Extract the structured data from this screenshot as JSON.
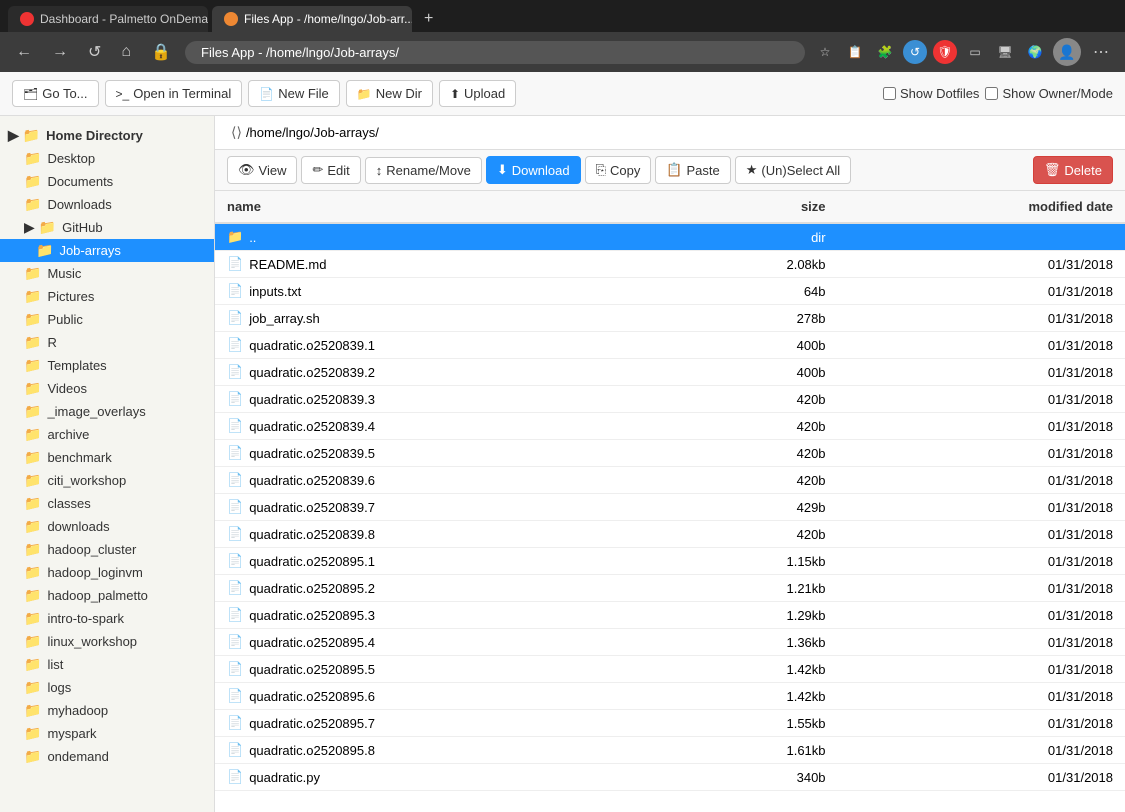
{
  "browser": {
    "tabs": [
      {
        "id": "tab1",
        "label": "Dashboard - Palmetto OnDema...",
        "active": false,
        "faviconColor": "red"
      },
      {
        "id": "tab2",
        "label": "Files App - /home/lngo/Job-arr...",
        "active": true,
        "faviconColor": "orange"
      }
    ],
    "new_tab_label": "+",
    "address": "Files App - /home/lngo/Job-arrays/",
    "nav": {
      "back": "←",
      "forward": "→",
      "reload": "↺",
      "home": "⌂",
      "lock": "🔒"
    }
  },
  "toolbar": {
    "goto_label": "Go To...",
    "terminal_label": "Open in Terminal",
    "new_file_label": "New File",
    "new_dir_label": "New Dir",
    "upload_label": "Upload",
    "show_dotfiles_label": "Show Dotfiles",
    "show_owner_label": "Show Owner/Mode"
  },
  "breadcrumb": {
    "icon": "⟨⟩",
    "path": "/home/lngo/Job-arrays/"
  },
  "file_toolbar": {
    "view_label": "View",
    "edit_label": "Edit",
    "rename_label": "Rename/Move",
    "download_label": "Download",
    "copy_label": "Copy",
    "paste_label": "Paste",
    "unselect_label": "(Un)Select All",
    "delete_label": "Delete"
  },
  "file_list": {
    "columns": [
      "name",
      "size",
      "modified date"
    ],
    "rows": [
      {
        "name": "..",
        "icon": "📁",
        "size": "dir",
        "date": "",
        "type": "dir",
        "selected": true
      },
      {
        "name": "README.md",
        "icon": "📄",
        "size": "2.08kb",
        "date": "01/31/2018",
        "type": "file"
      },
      {
        "name": "inputs.txt",
        "icon": "📄",
        "size": "64b",
        "date": "01/31/2018",
        "type": "file"
      },
      {
        "name": "job_array.sh",
        "icon": "📄",
        "size": "278b",
        "date": "01/31/2018",
        "type": "file"
      },
      {
        "name": "quadratic.o2520839.1",
        "icon": "📄",
        "size": "400b",
        "date": "01/31/2018",
        "type": "file"
      },
      {
        "name": "quadratic.o2520839.2",
        "icon": "📄",
        "size": "400b",
        "date": "01/31/2018",
        "type": "file"
      },
      {
        "name": "quadratic.o2520839.3",
        "icon": "📄",
        "size": "420b",
        "date": "01/31/2018",
        "type": "file"
      },
      {
        "name": "quadratic.o2520839.4",
        "icon": "📄",
        "size": "420b",
        "date": "01/31/2018",
        "type": "file"
      },
      {
        "name": "quadratic.o2520839.5",
        "icon": "📄",
        "size": "420b",
        "date": "01/31/2018",
        "type": "file"
      },
      {
        "name": "quadratic.o2520839.6",
        "icon": "📄",
        "size": "420b",
        "date": "01/31/2018",
        "type": "file"
      },
      {
        "name": "quadratic.o2520839.7",
        "icon": "📄",
        "size": "429b",
        "date": "01/31/2018",
        "type": "file"
      },
      {
        "name": "quadratic.o2520839.8",
        "icon": "📄",
        "size": "420b",
        "date": "01/31/2018",
        "type": "file"
      },
      {
        "name": "quadratic.o2520895.1",
        "icon": "📄",
        "size": "1.15kb",
        "date": "01/31/2018",
        "type": "file"
      },
      {
        "name": "quadratic.o2520895.2",
        "icon": "📄",
        "size": "1.21kb",
        "date": "01/31/2018",
        "type": "file"
      },
      {
        "name": "quadratic.o2520895.3",
        "icon": "📄",
        "size": "1.29kb",
        "date": "01/31/2018",
        "type": "file"
      },
      {
        "name": "quadratic.o2520895.4",
        "icon": "📄",
        "size": "1.36kb",
        "date": "01/31/2018",
        "type": "file"
      },
      {
        "name": "quadratic.o2520895.5",
        "icon": "📄",
        "size": "1.42kb",
        "date": "01/31/2018",
        "type": "file"
      },
      {
        "name": "quadratic.o2520895.6",
        "icon": "📄",
        "size": "1.42kb",
        "date": "01/31/2018",
        "type": "file"
      },
      {
        "name": "quadratic.o2520895.7",
        "icon": "📄",
        "size": "1.55kb",
        "date": "01/31/2018",
        "type": "file"
      },
      {
        "name": "quadratic.o2520895.8",
        "icon": "📄",
        "size": "1.61kb",
        "date": "01/31/2018",
        "type": "file"
      },
      {
        "name": "quadratic.py",
        "icon": "📄",
        "size": "340b",
        "date": "01/31/2018",
        "type": "file"
      }
    ]
  },
  "sidebar": {
    "root_label": "Home Directory",
    "items": [
      {
        "id": "desktop",
        "label": "Desktop",
        "level": "level1",
        "selected": false
      },
      {
        "id": "documents",
        "label": "Documents",
        "level": "level1",
        "selected": false
      },
      {
        "id": "downloads",
        "label": "Downloads",
        "level": "level1",
        "selected": false
      },
      {
        "id": "github",
        "label": "GitHub",
        "level": "level1",
        "selected": false
      },
      {
        "id": "job-arrays",
        "label": "Job-arrays",
        "level": "level2",
        "selected": true
      },
      {
        "id": "music",
        "label": "Music",
        "level": "level1",
        "selected": false
      },
      {
        "id": "pictures",
        "label": "Pictures",
        "level": "level1",
        "selected": false
      },
      {
        "id": "public",
        "label": "Public",
        "level": "level1",
        "selected": false
      },
      {
        "id": "r",
        "label": "R",
        "level": "level1",
        "selected": false
      },
      {
        "id": "templates",
        "label": "Templates",
        "level": "level1",
        "selected": false
      },
      {
        "id": "videos",
        "label": "Videos",
        "level": "level1",
        "selected": false
      },
      {
        "id": "image_overlays",
        "label": "_image_overlays",
        "level": "level1",
        "selected": false
      },
      {
        "id": "archive",
        "label": "archive",
        "level": "level1",
        "selected": false
      },
      {
        "id": "benchmark",
        "label": "benchmark",
        "level": "level1",
        "selected": false
      },
      {
        "id": "citi_workshop",
        "label": "citi_workshop",
        "level": "level1",
        "selected": false
      },
      {
        "id": "classes",
        "label": "classes",
        "level": "level1",
        "selected": false
      },
      {
        "id": "downloads2",
        "label": "downloads",
        "level": "level1",
        "selected": false
      },
      {
        "id": "hadoop_cluster",
        "label": "hadoop_cluster",
        "level": "level1",
        "selected": false
      },
      {
        "id": "hadoop_loginvm",
        "label": "hadoop_loginvm",
        "level": "level1",
        "selected": false
      },
      {
        "id": "hadoop_palmetto",
        "label": "hadoop_palmetto",
        "level": "level1",
        "selected": false
      },
      {
        "id": "intro-to-spark",
        "label": "intro-to-spark",
        "level": "level1",
        "selected": false
      },
      {
        "id": "linux_workshop",
        "label": "linux_workshop",
        "level": "level1",
        "selected": false
      },
      {
        "id": "list",
        "label": "list",
        "level": "level1",
        "selected": false
      },
      {
        "id": "logs",
        "label": "logs",
        "level": "level1",
        "selected": false
      },
      {
        "id": "myhadoop",
        "label": "myhadoop",
        "level": "level1",
        "selected": false
      },
      {
        "id": "myspark",
        "label": "myspark",
        "level": "level1",
        "selected": false
      },
      {
        "id": "ondemand",
        "label": "ondemand",
        "level": "level1",
        "selected": false
      }
    ]
  }
}
